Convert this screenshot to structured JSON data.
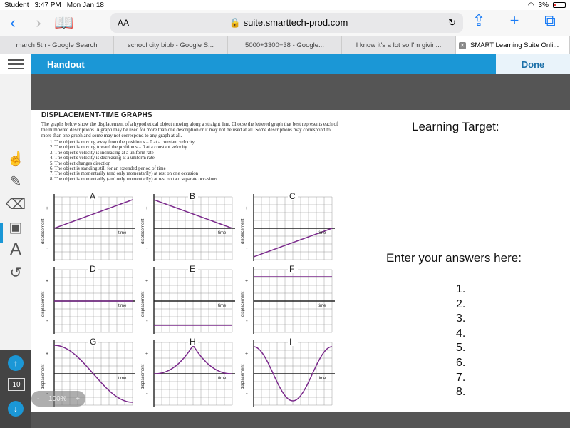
{
  "status_bar": {
    "carrier": "Student",
    "time": "3:47 PM",
    "date": "Mon Jan 18",
    "battery": "3%"
  },
  "browser": {
    "text_size_label": "AA",
    "url": "suite.smarttech-prod.com",
    "tabs": [
      {
        "label": "march 5th - Google Search",
        "active": false
      },
      {
        "label": "school city bibb - Google S...",
        "active": false
      },
      {
        "label": "5000+3300+38 - Google...",
        "active": false
      },
      {
        "label": "I know it's a lot so I'm givin...",
        "active": false
      },
      {
        "label": "SMART Learning Suite Onli...",
        "active": true
      }
    ]
  },
  "app": {
    "title": "Handout",
    "done_label": "Done",
    "accent": "#1b97d6"
  },
  "sidebar": {
    "tools": [
      {
        "name": "select-tool-icon",
        "glyph": "☝",
        "active": true
      },
      {
        "name": "pen-tool-icon",
        "glyph": "✎",
        "active": false
      },
      {
        "name": "eraser-tool-icon",
        "glyph": "⌫",
        "active": false
      },
      {
        "name": "add-image-tool-icon",
        "glyph": "▣",
        "active": false
      },
      {
        "name": "text-tool-icon",
        "glyph": "A",
        "active": false
      },
      {
        "name": "undo-tool-icon",
        "glyph": "↺",
        "active": false
      }
    ],
    "page_up": "↑",
    "page_number": "10",
    "page_down": "↓"
  },
  "zoom_control": {
    "minus": "-",
    "value": "100%",
    "plus": "+"
  },
  "worksheet": {
    "title": "DISPLACEMENT-TIME GRAPHS",
    "intro": "The graphs below show the displacement of a hypothetical object moving along a straight line. Choose the lettered graph that best represents each of the numbered descriptions. A graph may be used for more than one description or it may not be used at all. Some descriptions may correspond to more than one graph and some may not correspond to any graph at all.",
    "descriptions": [
      "1. The object is moving away from the position s = 0 at a constant velocity",
      "2. The object is moving toward the position s = 0 at a constant velocity",
      "3. The object's velocity is increasing at a uniform rate",
      "4. The object's velocity is decreasing at a uniform rate",
      "5. The object changes direction",
      "6. The object is standing still for an extended period of time",
      "7. The object is momentarily (and only momentarily) at rest on one occasion",
      "8. The object is momentarily (and only momentarily) at rest on two separate occasions"
    ],
    "axis": {
      "y_label": "displacement",
      "x_label": "time",
      "plus": "+",
      "minus": "-"
    },
    "graphs": [
      {
        "letter": "A",
        "shape": "line-up-from-origin"
      },
      {
        "letter": "B",
        "shape": "line-down-to-axis"
      },
      {
        "letter": "C",
        "shape": "line-up-from-negative"
      },
      {
        "letter": "D",
        "shape": "flat-on-axis"
      },
      {
        "letter": "E",
        "shape": "flat-negative"
      },
      {
        "letter": "F",
        "shape": "flat-positive"
      },
      {
        "letter": "G",
        "shape": "s-curve-down"
      },
      {
        "letter": "H",
        "shape": "cusp-peak"
      },
      {
        "letter": "I",
        "shape": "u-trough"
      }
    ],
    "curve_color": "#7b2a8c"
  },
  "right_panel": {
    "learning_target_label": "Learning Target:",
    "enter_answers_label": "Enter your answers here:",
    "answers": [
      "1.",
      "2.",
      "3.",
      "4.",
      "5.",
      "6.",
      "7.",
      "8."
    ]
  }
}
